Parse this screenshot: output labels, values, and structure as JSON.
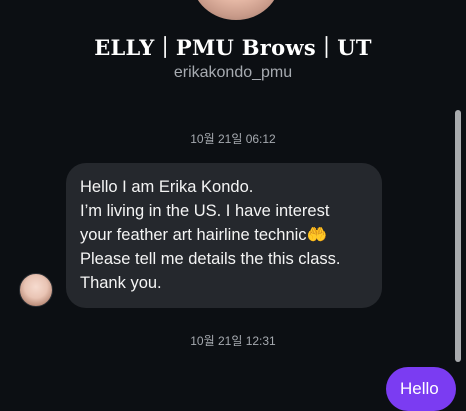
{
  "header": {
    "title": "ELLY｜PMU Brows｜UT",
    "handle": "erikakondo_pmu"
  },
  "messages": {
    "first_timestamp": "10월 21일 06:12",
    "incoming_lines": [
      "Hello I am Erika Kondo.",
      "I’m living in the US. I have interest",
      "your feather art hairline technic🤲",
      "Please tell me details the this class.",
      "Thank you."
    ],
    "second_timestamp": "10월 21일 12:31",
    "outgoing_text": "Hello"
  },
  "colors": {
    "background": "#0c0f13",
    "incoming_bubble": "#25282d",
    "outgoing_bubble": "#7b3cf2"
  }
}
